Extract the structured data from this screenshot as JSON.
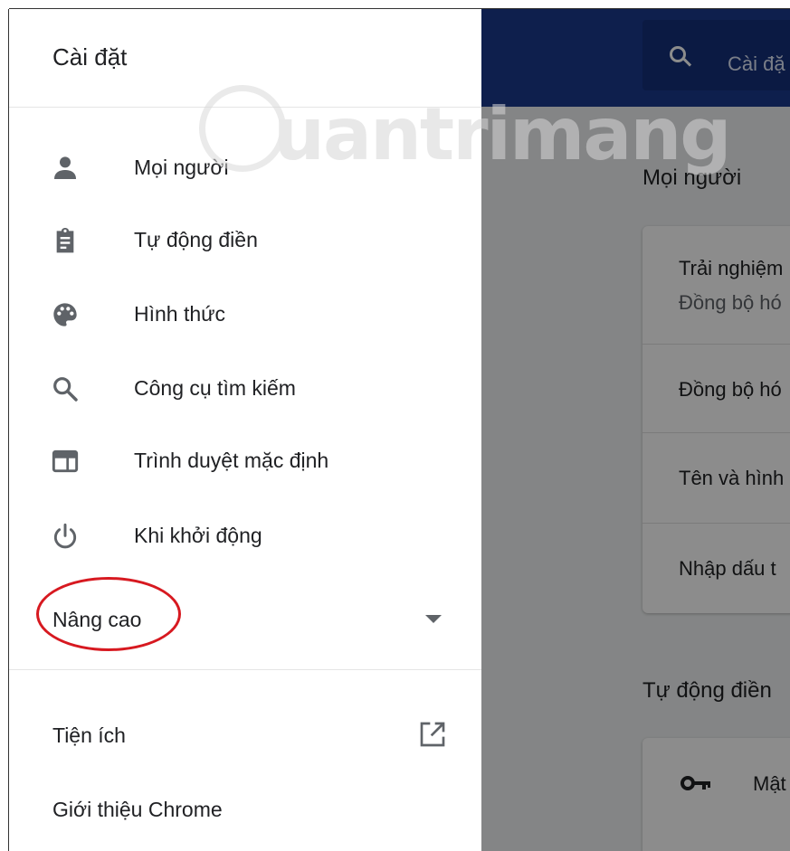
{
  "drawer": {
    "title": "Cài đặt",
    "items": [
      {
        "label": "Mọi người",
        "icon": "person-icon"
      },
      {
        "label": "Tự động điền",
        "icon": "clipboard-icon"
      },
      {
        "label": "Hình thức",
        "icon": "palette-icon"
      },
      {
        "label": "Công cụ tìm kiếm",
        "icon": "search-icon"
      },
      {
        "label": "Trình duyệt mặc định",
        "icon": "browser-window-icon"
      },
      {
        "label": "Khi khởi động",
        "icon": "power-icon"
      }
    ],
    "advanced": {
      "label": "Nâng cao",
      "icon": "caret-down-icon"
    },
    "footer": [
      {
        "label": "Tiện ích",
        "icon": "open-in-new-icon"
      },
      {
        "label": "Giới thiệu Chrome"
      }
    ]
  },
  "background": {
    "search_placeholder": "Cài đặ",
    "section_people": "Mọi người",
    "people_rows": [
      {
        "title": "Trải nghiệm",
        "subtitle": "Đồng bộ hó"
      },
      {
        "title": "Đồng bộ hó"
      },
      {
        "title": "Tên và hình"
      },
      {
        "title": "Nhập dấu t"
      }
    ],
    "section_autofill": "Tự động điền",
    "autofill_rows": [
      {
        "title": "Mật",
        "icon": "key-icon"
      }
    ]
  },
  "watermark": {
    "text": "uantrimang"
  },
  "colors": {
    "header": "#1a3a8c",
    "highlight_oval": "#d71920"
  }
}
